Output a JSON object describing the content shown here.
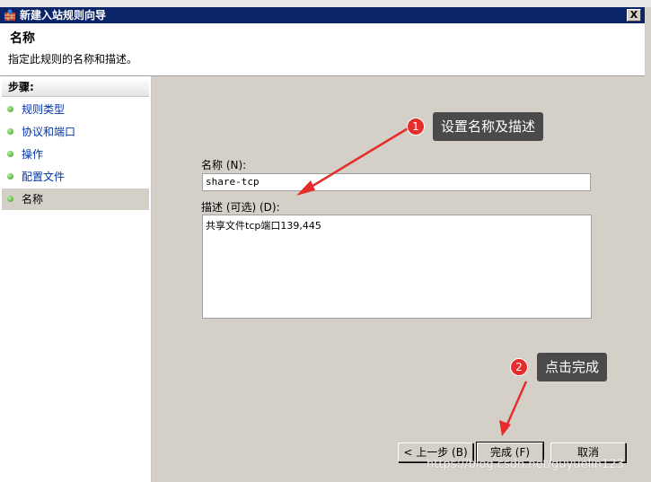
{
  "window": {
    "title": "新建入站规则向导",
    "close_glyph": "X"
  },
  "header": {
    "title": "名称",
    "description": "指定此规则的名称和描述。"
  },
  "sidebar": {
    "heading": "步骤:",
    "items": [
      {
        "label": "规则类型"
      },
      {
        "label": "协议和端口"
      },
      {
        "label": "操作"
      },
      {
        "label": "配置文件"
      },
      {
        "label": "名称",
        "active": true
      }
    ]
  },
  "form": {
    "name_label": "名称 (N):",
    "name_value": "share-tcp",
    "desc_label": "描述 (可选) (D):",
    "desc_value": "共享文件tcp端口139,445"
  },
  "buttons": {
    "back": "< 上一步 (B)",
    "finish": "完成 (F)",
    "cancel": "取消"
  },
  "annotations": [
    {
      "number": "1",
      "text": "设置名称及描述"
    },
    {
      "number": "2",
      "text": "点击完成"
    }
  ],
  "watermark": "https://blog.csdn.net/guyuelin123",
  "colors": {
    "titlebar": "#0a246a",
    "callout": "#4a4a4a",
    "badge": "#e52d2d",
    "arrow": "#e52d2d"
  }
}
